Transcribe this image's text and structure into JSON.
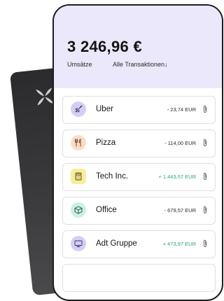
{
  "balance": "3 246,96 €",
  "tabs": {
    "umsaetze": "Umsätze",
    "alle": "Alle Transaktionen↓"
  },
  "colors": {
    "header_bg": "#ece8fb",
    "positive": "#2fa36b",
    "card": "#2b2b2e"
  },
  "transactions": [
    {
      "name": "Uber",
      "amount": "- 23,74 EUR",
      "icon": "rocket-icon",
      "icon_bg": "#d6cdf6",
      "positive": false
    },
    {
      "name": "Pizza",
      "amount": "- 114,00 EUR",
      "icon": "fork-knife-icon",
      "icon_bg": "#fbdcc6",
      "positive": false
    },
    {
      "name": "Tech Inc.",
      "amount": "+ 1.443,57 EUR",
      "icon": "calculator-icon",
      "icon_bg": "#f6ee9a",
      "positive": true
    },
    {
      "name": "Office",
      "amount": "- 679,57 EUR",
      "icon": "box-icon",
      "icon_bg": "#c9f0e2",
      "positive": false
    },
    {
      "name": "Adt Gruppe",
      "amount": "+ 473,97 EUR",
      "icon": "monitor-icon",
      "icon_bg": "#d6cdf6",
      "positive": true
    }
  ]
}
